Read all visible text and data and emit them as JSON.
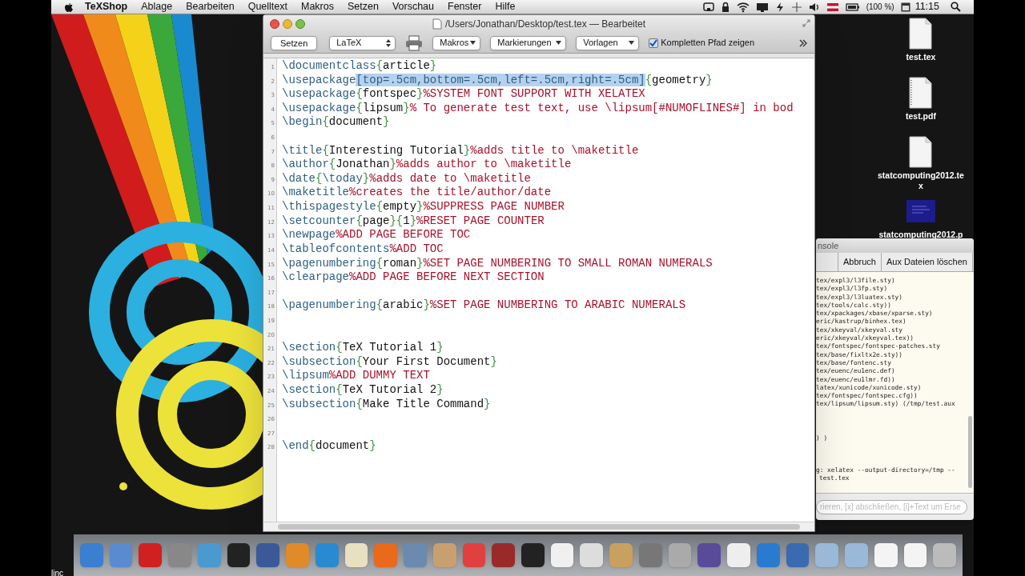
{
  "menu_bar": {
    "app_name": "TeXShop",
    "menus": [
      "Ablage",
      "Bearbeiten",
      "Quelltext",
      "Makros",
      "Setzen",
      "Vorschau",
      "Fenster",
      "Hilfe"
    ],
    "battery": "(100 %)",
    "clock": "11:15"
  },
  "desktop_icons": [
    {
      "label": "test.tex",
      "kind": "tex"
    },
    {
      "label": "test.pdf",
      "kind": "pdf"
    },
    {
      "label": "statcomputing2012.tex",
      "kind": "tex"
    },
    {
      "label": "statcomputing2012.p",
      "kind": "preview"
    }
  ],
  "desktop_text": "linc",
  "console": {
    "title": "nsole",
    "buttons": [
      "Abbruch",
      "Aux Dateien löschen"
    ],
    "log": [
      "tex/expl3/l3file.sty)",
      "tex/expl3/l3fp.sty)",
      "tex/expl3/l3luatex.sty)",
      "tex/tools/calc.sty))",
      "tex/xpackages/xbase/xparse.sty)",
      "eric/kastrup/binhex.tex)",
      "tex/xkeyval/xkeyval.sty",
      "eric/xkeyval/xkeyval.tex))",
      "tex/fontspec/fontspec-patches.sty",
      "tex/base/fixltx2e.sty))",
      "tex/base/fontenc.sty",
      "tex/euenc/eu1enc.def)",
      "tex/euenc/eu1lmr.fd))",
      "latex/xunicode/xunicode.sty)",
      "tex/fontspec/fontspec.cfg))",
      "tex/lipsum/lipsum.sty) (/tmp/test.aux"
    ],
    "tail": [
      ") )"
    ],
    "command": [
      "g: xelatex --output-directory=/tmp --",
      "test.tex"
    ],
    "input": {
      "placeholder": "rieren, [x] abschließen, [i]+Text um Erse"
    }
  },
  "editor": {
    "title": "/Users/Jonathan/Desktop/test.tex — Bearbeitet",
    "toolbar": {
      "typeset_button": "Setzen",
      "engine": "LaTeX",
      "menus": [
        "Makros",
        "Markierungen",
        "Vorlagen"
      ],
      "path_checkbox": {
        "label": "Kompletten Pfad zeigen",
        "checked": true
      }
    },
    "lines": [
      {
        "number": "1",
        "tokens": [
          {
            "kind": "command",
            "text": "\\documentclass"
          },
          {
            "kind": "brace",
            "text": "{"
          },
          {
            "kind": "text",
            "text": "article"
          },
          {
            "kind": "brace",
            "text": "}"
          }
        ]
      },
      {
        "number": "2",
        "tokens": [
          {
            "kind": "command",
            "text": "\\usepackage"
          },
          {
            "kind": "selection",
            "text": "[top=.5cm,bottom=.5cm,left=.5cm,right=.5cm]"
          },
          {
            "kind": "brace",
            "text": "{"
          },
          {
            "kind": "text",
            "text": "geometry"
          },
          {
            "kind": "brace",
            "text": "}"
          }
        ]
      },
      {
        "number": "3",
        "tokens": [
          {
            "kind": "command",
            "text": "\\usepackage"
          },
          {
            "kind": "brace",
            "text": "{"
          },
          {
            "kind": "text",
            "text": "fontspec"
          },
          {
            "kind": "brace",
            "text": "}"
          },
          {
            "kind": "comment",
            "text": "%SYSTEM FONT SUPPORT WITH XELATEX"
          }
        ]
      },
      {
        "number": "4",
        "tokens": [
          {
            "kind": "command",
            "text": "\\usepackage"
          },
          {
            "kind": "brace",
            "text": "{"
          },
          {
            "kind": "text",
            "text": "lipsum"
          },
          {
            "kind": "brace",
            "text": "}"
          },
          {
            "kind": "comment",
            "text": "% To generate test text, use \\lipsum[#NUMOFLINES#] in bod"
          }
        ]
      },
      {
        "number": "5",
        "tokens": [
          {
            "kind": "command",
            "text": "\\begin"
          },
          {
            "kind": "brace",
            "text": "{"
          },
          {
            "kind": "text",
            "text": "document"
          },
          {
            "kind": "brace",
            "text": "}"
          }
        ]
      },
      {
        "number": "6"
      },
      {
        "number": "7",
        "tokens": [
          {
            "kind": "command",
            "text": "\\title"
          },
          {
            "kind": "brace",
            "text": "{"
          },
          {
            "kind": "text",
            "text": "Interesting Tutorial"
          },
          {
            "kind": "brace",
            "text": "}"
          },
          {
            "kind": "comment",
            "text": "%adds title to \\maketitle"
          }
        ]
      },
      {
        "number": "8",
        "tokens": [
          {
            "kind": "command",
            "text": "\\author"
          },
          {
            "kind": "brace",
            "text": "{"
          },
          {
            "kind": "text",
            "text": "Jonathan"
          },
          {
            "kind": "brace",
            "text": "}"
          },
          {
            "kind": "comment",
            "text": "%adds author to \\maketitle"
          }
        ]
      },
      {
        "number": "9",
        "tokens": [
          {
            "kind": "command",
            "text": "\\date"
          },
          {
            "kind": "brace",
            "text": "{"
          },
          {
            "kind": "command",
            "text": "\\today"
          },
          {
            "kind": "brace",
            "text": "}"
          },
          {
            "kind": "comment",
            "text": "%adds date to \\maketitle"
          }
        ]
      },
      {
        "number": "10",
        "tokens": [
          {
            "kind": "command",
            "text": "\\maketitle"
          },
          {
            "kind": "comment",
            "text": "%creates the title/author/date"
          }
        ]
      },
      {
        "number": "11",
        "tokens": [
          {
            "kind": "command",
            "text": "\\thispagestyle"
          },
          {
            "kind": "brace",
            "text": "{"
          },
          {
            "kind": "text",
            "text": "empty"
          },
          {
            "kind": "brace",
            "text": "}"
          },
          {
            "kind": "comment",
            "text": "%SUPPRESS PAGE NUMBER"
          }
        ]
      },
      {
        "number": "12",
        "tokens": [
          {
            "kind": "command",
            "text": "\\setcounter"
          },
          {
            "kind": "brace",
            "text": "{"
          },
          {
            "kind": "text",
            "text": "page"
          },
          {
            "kind": "brace",
            "text": "}{"
          },
          {
            "kind": "text",
            "text": "1"
          },
          {
            "kind": "brace",
            "text": "}"
          },
          {
            "kind": "comment",
            "text": "%RESET PAGE COUNTER"
          }
        ]
      },
      {
        "number": "13",
        "tokens": [
          {
            "kind": "command",
            "text": "\\newpage"
          },
          {
            "kind": "comment",
            "text": "%ADD PAGE BEFORE TOC"
          }
        ]
      },
      {
        "number": "14",
        "tokens": [
          {
            "kind": "command",
            "text": "\\tableofcontents"
          },
          {
            "kind": "comment",
            "text": "%ADD TOC"
          }
        ]
      },
      {
        "number": "15",
        "tokens": [
          {
            "kind": "command",
            "text": "\\pagenumbering"
          },
          {
            "kind": "brace",
            "text": "{"
          },
          {
            "kind": "text",
            "text": "roman"
          },
          {
            "kind": "brace",
            "text": "}"
          },
          {
            "kind": "comment",
            "text": "%SET PAGE NUMBERING TO SMALL ROMAN NUMERALS"
          }
        ]
      },
      {
        "number": "16",
        "tokens": [
          {
            "kind": "command",
            "text": "\\clearpage"
          },
          {
            "kind": "comment",
            "text": "%ADD PAGE BEFORE NEXT SECTION"
          }
        ]
      },
      {
        "number": "17"
      },
      {
        "number": "18",
        "tokens": [
          {
            "kind": "command",
            "text": "\\pagenumbering"
          },
          {
            "kind": "brace",
            "text": "{"
          },
          {
            "kind": "text",
            "text": "arabic"
          },
          {
            "kind": "brace",
            "text": "}"
          },
          {
            "kind": "comment",
            "text": "%SET PAGE NUMBERING TO ARABIC NUMERALS"
          }
        ]
      },
      {
        "number": "19"
      },
      {
        "number": "20"
      },
      {
        "number": "21",
        "tokens": [
          {
            "kind": "command",
            "text": "\\section"
          },
          {
            "kind": "brace",
            "text": "{"
          },
          {
            "kind": "text",
            "text": "TeX Tutorial 1"
          },
          {
            "kind": "brace",
            "text": "}"
          }
        ]
      },
      {
        "number": "22",
        "tokens": [
          {
            "kind": "command",
            "text": "\\subsection"
          },
          {
            "kind": "brace",
            "text": "{"
          },
          {
            "kind": "text",
            "text": "Your First Document"
          },
          {
            "kind": "brace",
            "text": "}"
          }
        ]
      },
      {
        "number": "23",
        "tokens": [
          {
            "kind": "command",
            "text": "\\lipsum"
          },
          {
            "kind": "comment",
            "text": "%ADD DUMMY TEXT"
          }
        ]
      },
      {
        "number": "24",
        "tokens": [
          {
            "kind": "command",
            "text": "\\section"
          },
          {
            "kind": "brace",
            "text": "{"
          },
          {
            "kind": "text",
            "text": "TeX Tutorial 2"
          },
          {
            "kind": "brace",
            "text": "}"
          }
        ]
      },
      {
        "number": "25",
        "tokens": [
          {
            "kind": "command",
            "text": "\\subsection"
          },
          {
            "kind": "brace",
            "text": "{"
          },
          {
            "kind": "text",
            "text": "Make Title Command"
          },
          {
            "kind": "brace",
            "text": "}"
          }
        ]
      },
      {
        "number": "26"
      },
      {
        "number": "27"
      },
      {
        "number": "28",
        "tokens": [
          {
            "kind": "command",
            "text": "\\end"
          },
          {
            "kind": "brace",
            "text": "{"
          },
          {
            "kind": "text",
            "text": "document"
          },
          {
            "kind": "brace",
            "text": "}"
          }
        ]
      }
    ]
  }
}
